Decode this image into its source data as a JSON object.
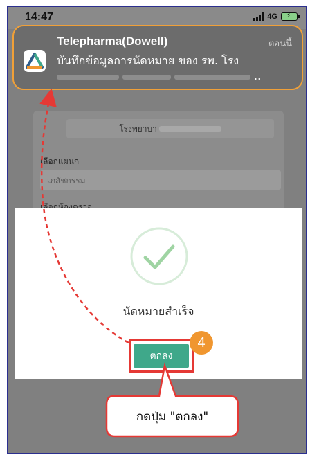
{
  "status_bar": {
    "time": "14:47",
    "network": "4G"
  },
  "notification": {
    "app_name": "Telepharma(Dowell)",
    "time": "ตอนนี้",
    "body": "บันทึกข้อมูลการนัดหมาย ของ รพ. โรง",
    "ellipsis": ".."
  },
  "background_form": {
    "hospital_label": "โรงพยาบา",
    "department_label": "เลือกแผนก",
    "department_value": "เภสัชกรรม",
    "room_label": "เลือกห้องตรวจ"
  },
  "dialog": {
    "message": "นัดหมายสำเร็จ",
    "ok_label": "ตกลง"
  },
  "annotation": {
    "step_number": "4",
    "callout_text": "กดปุ่ม \"ตกลง\"",
    "arrow_color": "#e53935",
    "highlight_color": "#f0a038"
  },
  "colors": {
    "ok_button": "#3fa88a",
    "check_mark": "#9fd4a3",
    "badge": "#f0962f"
  }
}
